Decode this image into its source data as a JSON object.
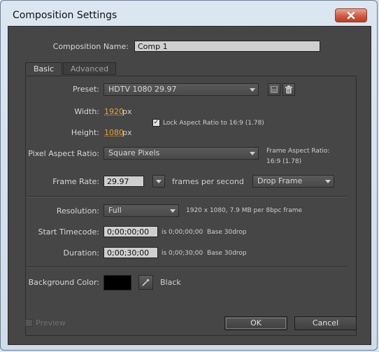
{
  "window": {
    "title": "Composition Settings"
  },
  "comp_name": {
    "label": "Composition Name:",
    "value": "Comp 1"
  },
  "tabs": [
    {
      "label": "Basic"
    },
    {
      "label": "Advanced"
    }
  ],
  "preset": {
    "label": "Preset:",
    "value": "HDTV 1080 29.97"
  },
  "width": {
    "label": "Width:",
    "value": "1920",
    "unit": "px"
  },
  "height": {
    "label": "Height:",
    "value": "1080",
    "unit": "px"
  },
  "lock_aspect": {
    "label": "Lock Aspect Ratio to 16:9 (1.78)",
    "checked": true
  },
  "pixel_aspect": {
    "label": "Pixel Aspect Ratio:",
    "value": "Square Pixels"
  },
  "frame_aspect": {
    "label": "Frame Aspect Ratio:",
    "value": "16:9 (1.78)"
  },
  "frame_rate": {
    "label": "Frame Rate:",
    "value": "29.97",
    "unit": "frames per second",
    "drop": "Drop Frame"
  },
  "resolution": {
    "label": "Resolution:",
    "value": "Full",
    "info": "1920 x 1080, 7.9 MB per 8bpc frame"
  },
  "start_timecode": {
    "label": "Start Timecode:",
    "value": "0;00;00;00",
    "info_prefix": "is 0;00;00;00",
    "info_base": "Base 30drop"
  },
  "duration": {
    "label": "Duration:",
    "value": "0;00;30;00",
    "info_prefix": "is 0;00;30;00",
    "info_base": "Base 30drop"
  },
  "background_color": {
    "label": "Background Color:",
    "name": "Black",
    "color": "#000000"
  },
  "footer": {
    "preview_label": "Preview",
    "ok_label": "OK",
    "cancel_label": "Cancel"
  },
  "icons": [
    "close-icon",
    "save-preset-icon",
    "trash-icon",
    "eyedropper-icon",
    "chevron-down-icon"
  ]
}
